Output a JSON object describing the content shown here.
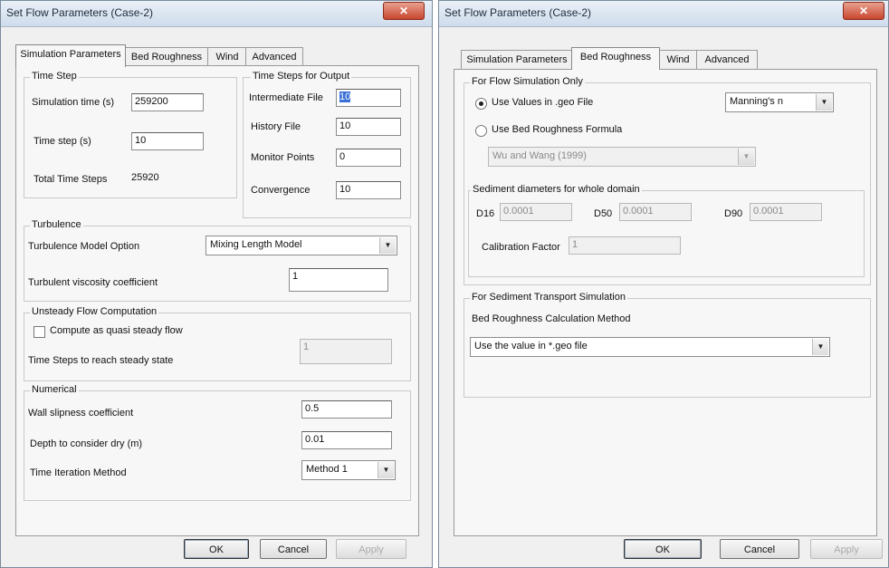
{
  "win1": {
    "title": "Set Flow Parameters (Case-2)",
    "close": "✕",
    "tabs": [
      "Simulation Parameters",
      "Bed Roughness",
      "Wind",
      "Advanced"
    ],
    "time_step": {
      "group": "Time Step",
      "sim_time_label": "Simulation time (s)",
      "sim_time_value": "259200",
      "time_step_label": "Time step (s)",
      "time_step_value": "10",
      "total_steps_label": "Total Time Steps",
      "total_steps_value": "25920"
    },
    "output": {
      "group": "Time Steps for Output",
      "intermediate_label": "Intermediate File",
      "intermediate_value": "10",
      "history_label": "History File",
      "history_value": "10",
      "monitor_label": "Monitor Points",
      "monitor_value": "0",
      "convergence_label": "Convergence",
      "convergence_value": "10"
    },
    "turbulence": {
      "group": "Turbulence",
      "model_label": "Turbulence Model Option",
      "model_value": "Mixing Length Model",
      "viscosity_label": "Turbulent viscosity coefficient",
      "viscosity_value": "1"
    },
    "unsteady": {
      "group": "Unsteady Flow Computation",
      "quasi_label": "Compute as quasi steady flow",
      "steps_label": "Time Steps to reach steady state",
      "steps_value": "1"
    },
    "numerical": {
      "group": "Numerical",
      "slipness_label": "Wall slipness coefficient",
      "slipness_value": "0.5",
      "depth_label": "Depth to consider dry (m)",
      "depth_value": "0.01",
      "iteration_label": "Time Iteration Method",
      "iteration_value": "Method 1"
    },
    "buttons": {
      "ok": "OK",
      "cancel": "Cancel",
      "apply": "Apply"
    }
  },
  "win2": {
    "title": "Set Flow Parameters (Case-2)",
    "close": "✕",
    "tabs": [
      "Simulation Parameters",
      "Bed Roughness",
      "Wind",
      "Advanced"
    ],
    "flow": {
      "group": "For Flow Simulation Only",
      "use_geo_label": "Use Values in .geo File",
      "manning_value": "Manning's n",
      "use_formula_label": "Use Bed Roughness Formula",
      "formula_value": "Wu and Wang (1999)",
      "sediment_group": "Sediment diameters for whole domain",
      "d16_label": "D16",
      "d16_value": "0.0001",
      "d50_label": "D50",
      "d50_value": "0.0001",
      "d90_label": "D90",
      "d90_value": "0.0001",
      "calibration_label": "Calibration Factor",
      "calibration_value": "1"
    },
    "sediment": {
      "group": "For Sediment Transport Simulation",
      "method_label": "Bed Roughness Calculation Method",
      "method_value": "Use the value in *.geo file"
    },
    "buttons": {
      "ok": "OK",
      "cancel": "Cancel",
      "apply": "Apply"
    }
  }
}
